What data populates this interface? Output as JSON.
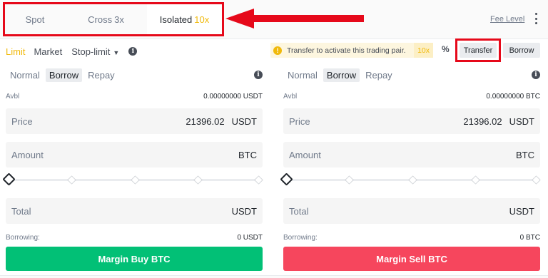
{
  "tabs": [
    {
      "label": "Spot"
    },
    {
      "label": "Cross",
      "leverage": "3x"
    },
    {
      "label": "Isolated",
      "leverage": "10x"
    }
  ],
  "header": {
    "fee_level": "Fee Level"
  },
  "order_types": {
    "limit": "Limit",
    "market": "Market",
    "stop_limit": "Stop-limit"
  },
  "notice": {
    "text": "Transfer to activate this trading pair.",
    "leverage": "10x"
  },
  "top_buttons": {
    "transfer": "Transfer",
    "borrow": "Borrow"
  },
  "buy": {
    "modes": [
      "Normal",
      "Borrow",
      "Repay"
    ],
    "avbl_label": "Avbl",
    "avbl_value": "0.00000000 USDT",
    "price_label": "Price",
    "price_value": "21396.02",
    "price_unit": "USDT",
    "amount_label": "Amount",
    "amount_unit": "BTC",
    "total_label": "Total",
    "total_unit": "USDT",
    "borrowing_label": "Borrowing:",
    "borrowing_value": "0 USDT",
    "button": "Margin Buy BTC"
  },
  "sell": {
    "modes": [
      "Normal",
      "Borrow",
      "Repay"
    ],
    "avbl_label": "Avbl",
    "avbl_value": "0.00000000 BTC",
    "price_label": "Price",
    "price_value": "21396.02",
    "price_unit": "USDT",
    "amount_label": "Amount",
    "amount_unit": "BTC",
    "total_label": "Total",
    "total_unit": "USDT",
    "borrowing_label": "Borrowing:",
    "borrowing_value": "0 BTC",
    "button": "Margin Sell BTC"
  },
  "colors": {
    "accent": "#f0b90b",
    "buy": "#02c076",
    "sell": "#f6465d",
    "highlight": "#e6091a"
  },
  "slider": {
    "buy_percent": 0,
    "sell_percent": 0
  }
}
